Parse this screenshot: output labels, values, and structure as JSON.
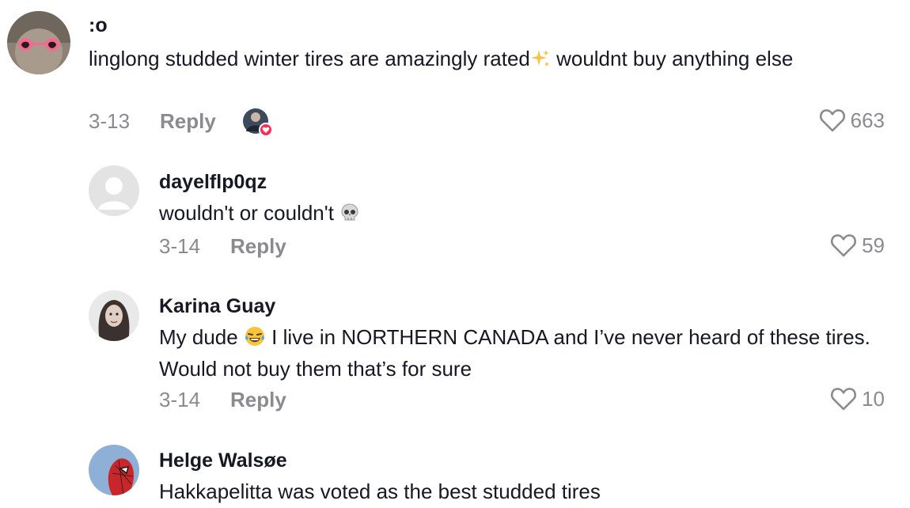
{
  "comments": [
    {
      "username": ":o",
      "text_a": "linglong studded winter tires are amazingly rated",
      "text_emoji": "sparkles",
      "text_b": " wouldnt buy anything else",
      "date": "3-13",
      "reply_label": "Reply",
      "likes": "663",
      "liked_by_creator": true
    },
    {
      "username": "dayelflp0qz",
      "text_a": "wouldn't or couldn't ",
      "text_emoji": "skull",
      "date": "3-14",
      "reply_label": "Reply",
      "likes": "59"
    },
    {
      "username": "Karina Guay",
      "text_a": "My dude ",
      "text_emoji": "joy",
      "text_b": " I live in NORTHERN CANADA and I’ve never heard of these tires. Would not buy them that’s for sure",
      "date": "3-14",
      "reply_label": "Reply",
      "likes": "10"
    },
    {
      "username": "Helge Walsøe",
      "text_a": "Hakkapelitta was voted as the best studded tires"
    }
  ],
  "icons": {
    "like": "heart-outline-icon",
    "creator_like": "creator-liked-badge-icon"
  },
  "colors": {
    "meta_gray": "#8a8b91",
    "text": "#161823",
    "creator_heart": "#fe2c55"
  }
}
